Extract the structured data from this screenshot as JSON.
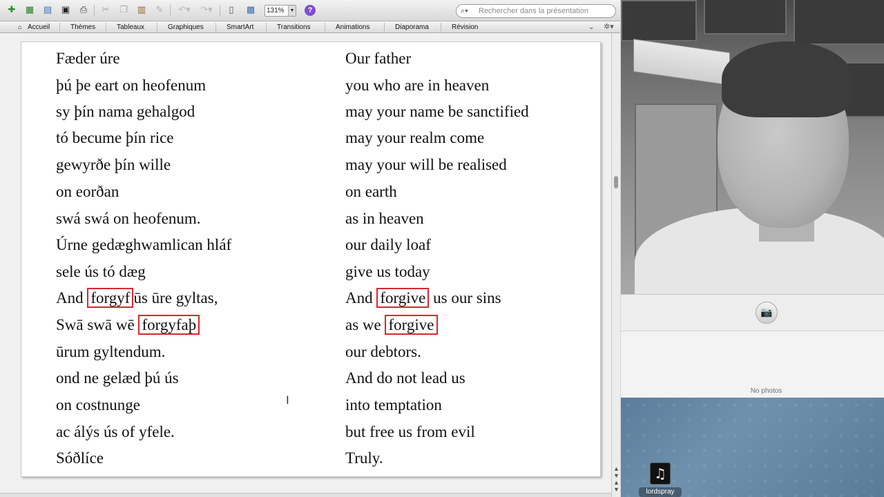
{
  "toolbar": {
    "zoom_value": "131%",
    "help_label": "?",
    "search_placeholder": "Rechercher dans la présentation"
  },
  "ribbon": {
    "tabs": [
      "Accueil",
      "Thèmes",
      "Tableaux",
      "Graphiques",
      "SmartArt",
      "Transitions",
      "Animations",
      "Diaporama",
      "Révision"
    ]
  },
  "slide": {
    "old_english": [
      "Fæder úre",
      "þú þe eart on heofenum",
      "sy þín nama gehalgod",
      "tó becume þín rice",
      "gewyrðe þín wille",
      "on eorðan",
      "swá swá on heofenum.",
      "Úrne gedæghwamlican hláf",
      "sele ús tó dæg",
      "And",
      "forgyf",
      "ūs ūre gyltas,",
      "Swā swā wē",
      "forgyfaþ",
      "ūrum gyltendum.",
      "ond ne gelæd þú ús",
      "on costnunge",
      "ac álýs ús of yfele.",
      "Sóðlíce"
    ],
    "modern_english": [
      "Our father",
      "you who are in heaven",
      "may your name be sanctified",
      "may your realm come",
      "may your will be realised",
      "on earth",
      "as in heaven",
      "our daily loaf",
      "give us today",
      "And",
      "forgive",
      "us our sins",
      "as we",
      "forgive",
      "our debtors.",
      "And do not lead us",
      "into temptation",
      "but free us from evil",
      "Truly."
    ]
  },
  "photobooth": {
    "empty_label": "No photos"
  },
  "desktop": {
    "icon_label": "lordspray"
  }
}
